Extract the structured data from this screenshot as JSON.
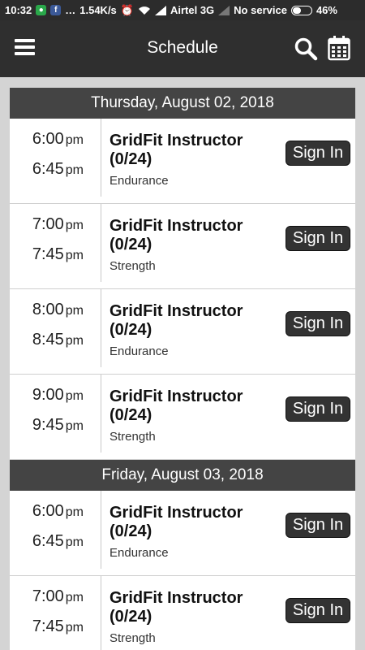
{
  "status_bar": {
    "time": "10:32",
    "speed": "1.54K/s",
    "carrier": "Airtel 3G",
    "service": "No service",
    "battery": "46%",
    "battery_level": 0.46
  },
  "app_bar": {
    "title": "Schedule"
  },
  "days": [
    {
      "date": "Thursday, August 02, 2018",
      "sessions": [
        {
          "start": "6:00",
          "start_suffix": "pm",
          "end": "6:45",
          "end_suffix": "pm",
          "name": "GridFit Instructor (0/24)",
          "category": "Endurance",
          "action": "Sign In"
        },
        {
          "start": "7:00",
          "start_suffix": "pm",
          "end": "7:45",
          "end_suffix": "pm",
          "name": "GridFit Instructor (0/24)",
          "category": "Strength",
          "action": "Sign In"
        },
        {
          "start": "8:00",
          "start_suffix": "pm",
          "end": "8:45",
          "end_suffix": "pm",
          "name": "GridFit Instructor (0/24)",
          "category": "Endurance",
          "action": "Sign In"
        },
        {
          "start": "9:00",
          "start_suffix": "pm",
          "end": "9:45",
          "end_suffix": "pm",
          "name": "GridFit Instructor (0/24)",
          "category": "Strength",
          "action": "Sign In"
        }
      ]
    },
    {
      "date": "Friday, August 03, 2018",
      "sessions": [
        {
          "start": "6:00",
          "start_suffix": "pm",
          "end": "6:45",
          "end_suffix": "pm",
          "name": "GridFit Instructor (0/24)",
          "category": "Endurance",
          "action": "Sign In"
        },
        {
          "start": "7:00",
          "start_suffix": "pm",
          "end": "7:45",
          "end_suffix": "pm",
          "name": "GridFit Instructor (0/24)",
          "category": "Strength",
          "action": "Sign In"
        }
      ]
    }
  ]
}
